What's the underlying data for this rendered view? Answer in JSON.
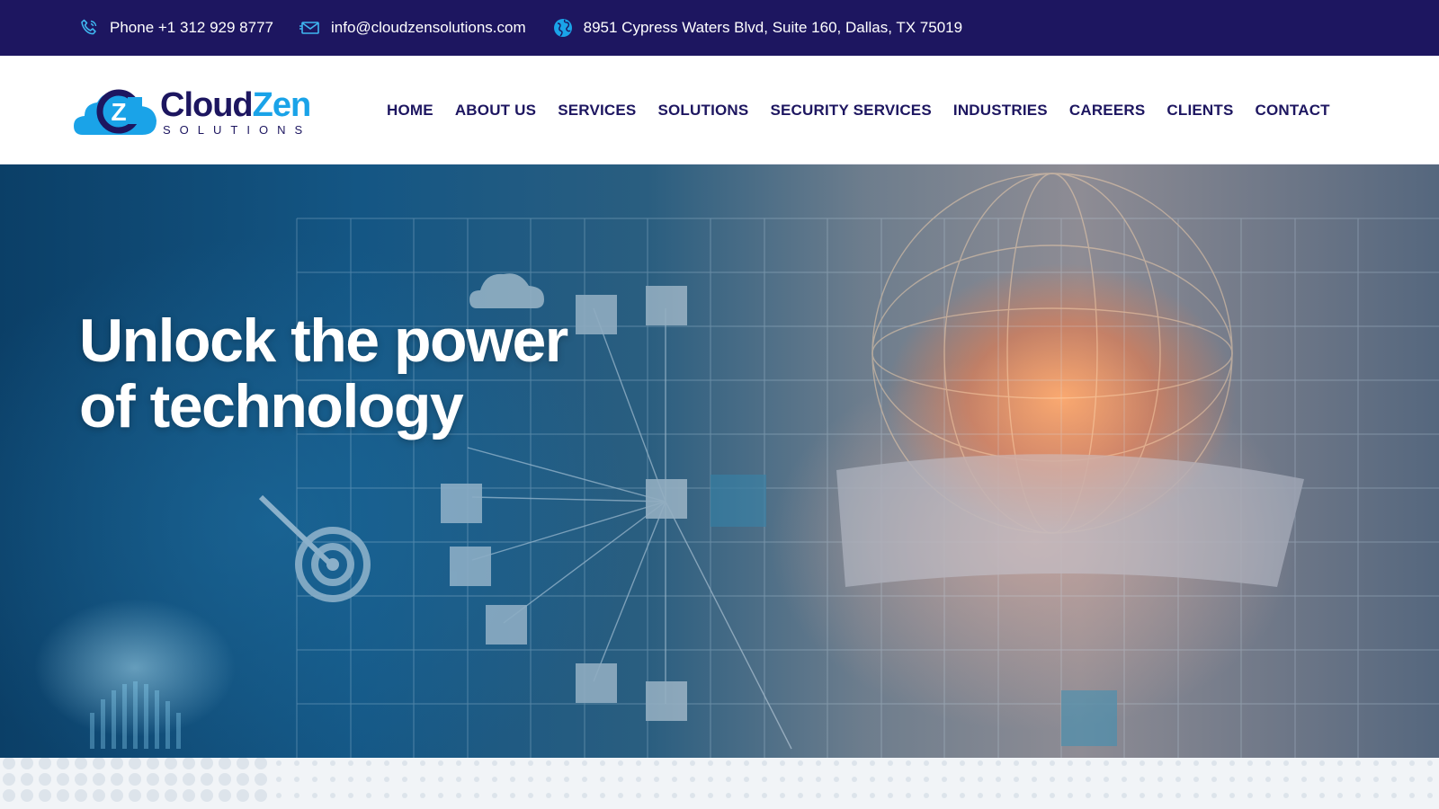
{
  "topbar": {
    "phone": {
      "icon": "phone-icon",
      "text": "Phone +1 312 929 8777"
    },
    "email": {
      "icon": "mail-icon",
      "text": "info@cloudzensolutions.com"
    },
    "address": {
      "icon": "globe-icon",
      "text": "8951 Cypress Waters Blvd, Suite 160, Dallas, TX 75019"
    }
  },
  "logo": {
    "part1": "Cloud",
    "part2": "Zen",
    "subtitle": "SOLUTIONS",
    "mark_letter": "Z"
  },
  "nav": {
    "items": [
      {
        "label": "HOME"
      },
      {
        "label": "ABOUT US"
      },
      {
        "label": "SERVICES"
      },
      {
        "label": "SOLUTIONS"
      },
      {
        "label": "SECURITY SERVICES"
      },
      {
        "label": "INDUSTRIES"
      },
      {
        "label": "CAREERS"
      },
      {
        "label": "CLIENTS"
      },
      {
        "label": "CONTACT"
      }
    ]
  },
  "hero": {
    "title_line1": "Unlock the power",
    "title_line2": "of technology"
  },
  "colors": {
    "brand_navy": "#1d1660",
    "brand_blue": "#1aa3e8",
    "white": "#ffffff"
  }
}
